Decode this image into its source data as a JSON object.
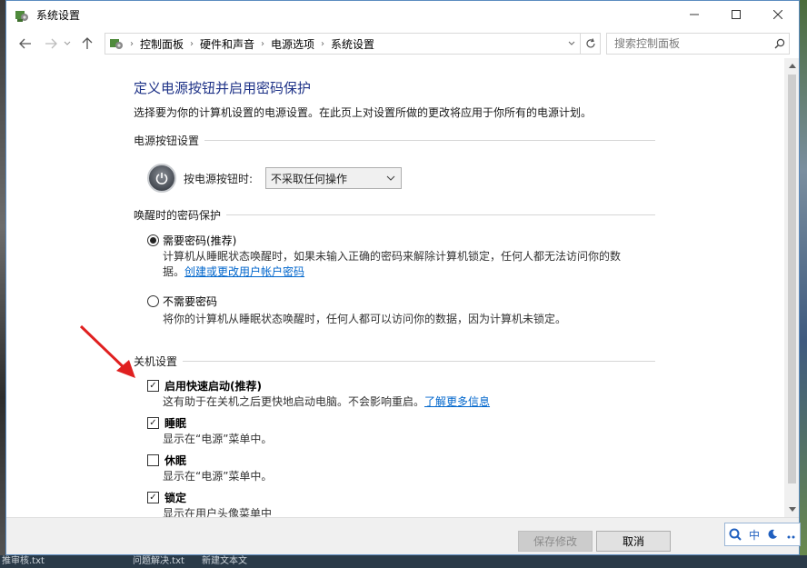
{
  "window": {
    "title": "系统设置",
    "min_icon": "minimize-icon",
    "max_icon": "maximize-icon",
    "close_icon": "close-icon"
  },
  "address": {
    "crumbs": [
      "控制面板",
      "硬件和声音",
      "电源选项",
      "系统设置"
    ],
    "search_placeholder": "搜索控制面板"
  },
  "page": {
    "title": "定义电源按钮并启用密码保护",
    "subtitle": "选择要为你的计算机设置的电源设置。在此页上对设置所做的更改将应用于你所有的电源计划。"
  },
  "power_buttons": {
    "section": "电源按钮设置",
    "label": "按电源按钮时:",
    "selected": "不采取任何操作"
  },
  "wake_password": {
    "section": "唤醒时的密码保护",
    "require": {
      "label": "需要密码(推荐)",
      "desc_line1": "计算机从睡眠状态唤醒时，如果未输入正确的密码来解除计算机锁定，任何人都无法访问你的数",
      "desc_line2_prefix": "据。",
      "link": "创建或更改用户帐户密码",
      "selected": true
    },
    "no_require": {
      "label": "不需要密码",
      "desc": "将你的计算机从睡眠状态唤醒时，任何人都可以访问你的数据，因为计算机未锁定。",
      "selected": false
    }
  },
  "shutdown": {
    "section": "关机设置",
    "items": [
      {
        "label": "启用快速启动(推荐)",
        "desc": "这有助于在关机之后更快地启动电脑。不会影响重启。",
        "link": "了解更多信息",
        "checked": true
      },
      {
        "label": "睡眠",
        "desc": "显示在“电源”菜单中。",
        "checked": true
      },
      {
        "label": "休眠",
        "desc": "显示在“电源”菜单中。",
        "checked": false
      },
      {
        "label": "锁定",
        "desc": "显示在用户头像菜单中",
        "checked": true
      }
    ]
  },
  "footer": {
    "save": "保存修改",
    "cancel": "取消"
  },
  "ime": {
    "mode": "中"
  },
  "taskbar_text": {
    "left": "推审核.txt",
    "mid": "问题解决.txt",
    "right": "新建文本文"
  },
  "colors": {
    "heading": "#1e3287",
    "link": "#0066cc",
    "annotation_arrow": "#e02020"
  }
}
